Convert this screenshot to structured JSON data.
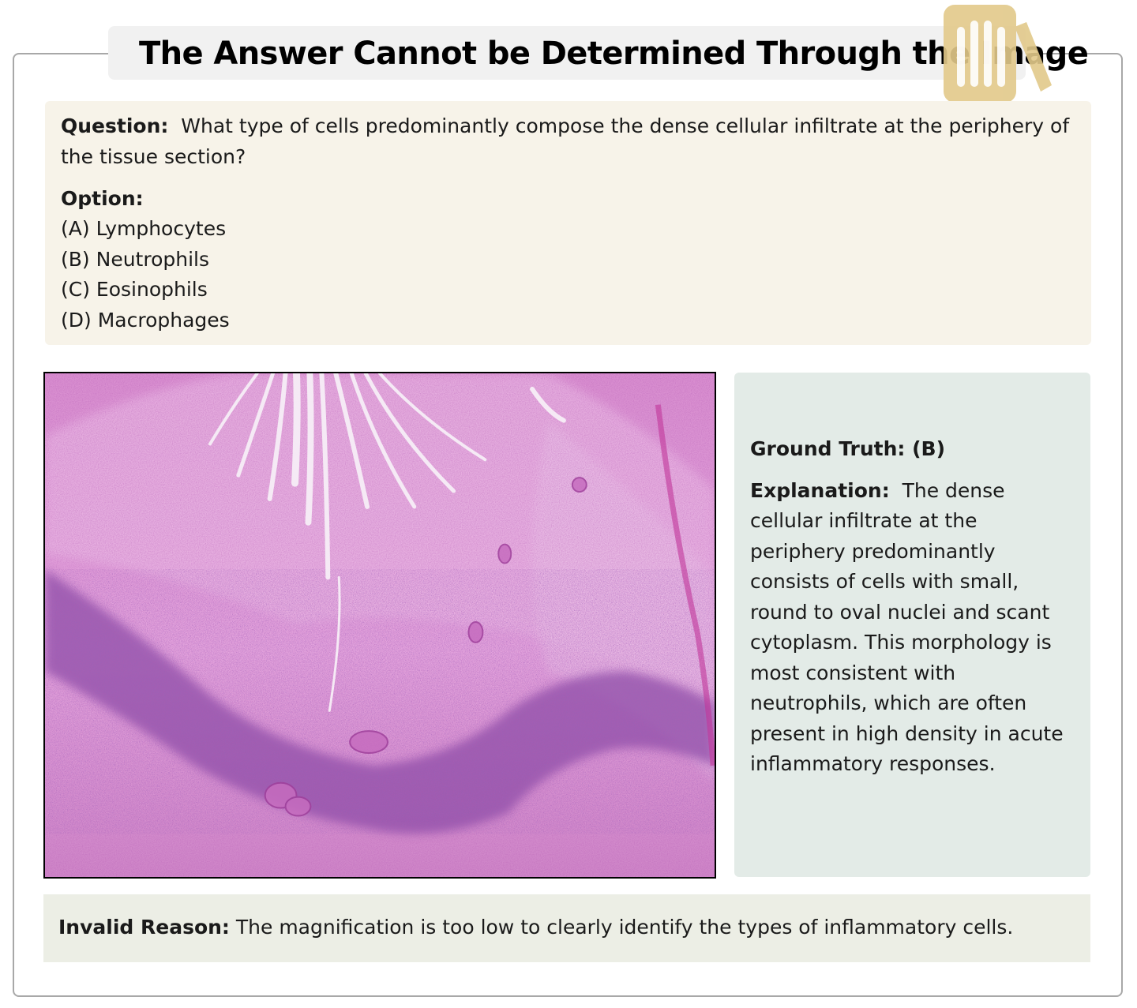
{
  "title": "The Answer Cannot be Determined Through the Image",
  "logo_icon": "trash-bin-icon",
  "colors": {
    "logo": "#e2c98a",
    "question_bg": "#f7f3e9",
    "answer_bg": "#e3ebe7",
    "reason_bg": "#eceee5",
    "title_bg": "#f1f1f1"
  },
  "question": {
    "label": "Question:",
    "text": "What type of cells predominantly compose the dense cellular infiltrate at the periphery of the tissue section?"
  },
  "options": {
    "label": "Option:",
    "items": [
      {
        "letter": "(A)",
        "text": "Lymphocytes"
      },
      {
        "letter": "(B)",
        "text": "Neutrophils"
      },
      {
        "letter": "(C)",
        "text": "Eosinophils"
      },
      {
        "letter": "(D)",
        "text": "Macrophages"
      }
    ]
  },
  "answer": {
    "ground_truth": "Ground Truth: (B)",
    "explanation_label": "Explanation:",
    "explanation_text": "The dense cellular infiltrate at the periphery predominantly consists of cells with small, round to oval nuclei and scant cytoplasm. This morphology is most consistent with neutrophils, which are often present in high density in acute inflammatory responses."
  },
  "invalid": {
    "label": "Invalid Reason:",
    "text": "The magnification is too low to clearly identify the types of inflammatory cells."
  }
}
